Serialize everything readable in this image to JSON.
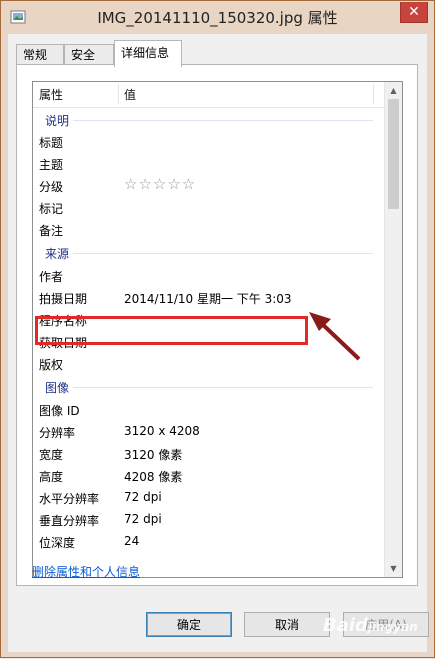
{
  "window": {
    "title": "IMG_20141110_150320.jpg 属性",
    "close_glyph": "✕"
  },
  "tabs": [
    {
      "label": "常规"
    },
    {
      "label": "安全"
    },
    {
      "label": "详细信息"
    }
  ],
  "columns": {
    "name": "属性",
    "value": "值"
  },
  "groups": {
    "description": "说明",
    "origin": "来源",
    "image": "图像"
  },
  "rows": {
    "title": {
      "name": "标题",
      "value": ""
    },
    "subject": {
      "name": "主题",
      "value": ""
    },
    "rating": {
      "name": "分级",
      "value": "☆☆☆☆☆",
      "stars": 0
    },
    "tags": {
      "name": "标记",
      "value": ""
    },
    "comments": {
      "name": "备注",
      "value": ""
    },
    "authors": {
      "name": "作者",
      "value": ""
    },
    "date_taken": {
      "name": "拍摄日期",
      "value": "2014/11/10 星期一 下午 3:03"
    },
    "program": {
      "name": "程序名称",
      "value": ""
    },
    "date_acquired": {
      "name": "获取日期",
      "value": ""
    },
    "copyright": {
      "name": "版权",
      "value": ""
    },
    "image_id": {
      "name": "图像 ID",
      "value": ""
    },
    "dimensions": {
      "name": "分辨率",
      "value": "3120 x 4208"
    },
    "width": {
      "name": "宽度",
      "value": "3120 像素"
    },
    "height": {
      "name": "高度",
      "value": "4208 像素"
    },
    "h_res": {
      "name": "水平分辨率",
      "value": "72 dpi"
    },
    "v_res": {
      "name": "垂直分辨率",
      "value": "72 dpi"
    },
    "bit_depth": {
      "name": "位深度",
      "value": "24"
    }
  },
  "remove_link": "删除属性和个人信息",
  "buttons": {
    "ok": "确定",
    "cancel": "取消",
    "apply": "应用(A)"
  },
  "colors": {
    "highlight": "#e02a2a",
    "arrow": "#8b1a1a",
    "link": "#0a5bd6"
  }
}
